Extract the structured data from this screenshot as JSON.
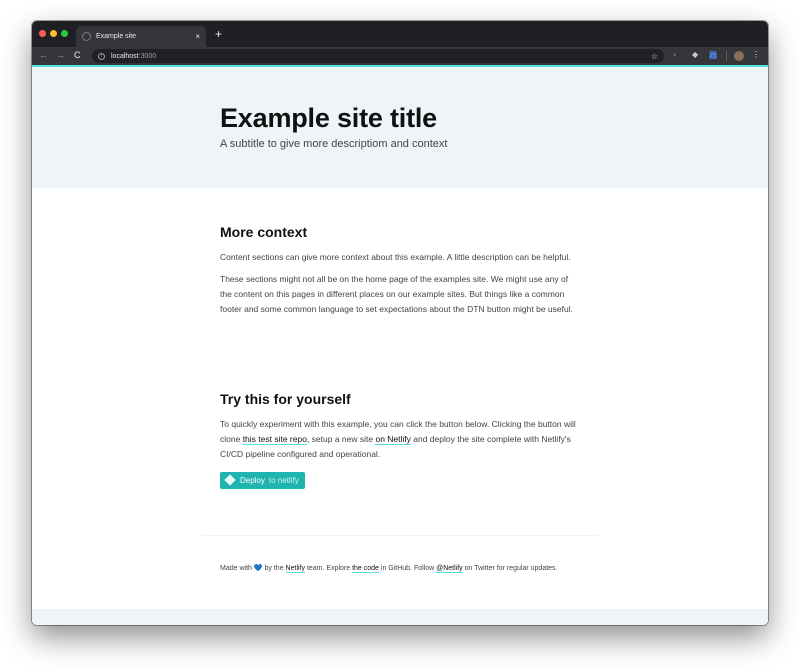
{
  "browser": {
    "tab_title": "Example site",
    "tab_close": "×",
    "new_tab": "+",
    "url_host": "localhost",
    "url_port": ":3000",
    "star": "☆",
    "menu": "⋮",
    "back": "←",
    "forward": "→",
    "reload": "C"
  },
  "hero": {
    "title": "Example site title",
    "subtitle": "A subtitle to give more descriptiom and context"
  },
  "section1": {
    "heading": "More context",
    "paragraphs": [
      "Content sections can give more context about this example. A little description can be helpful.",
      "These sections might not all be on the home page of the examples site. We might use any of the content on this pages in different places on our example sites. But things like a common footer and some common language to set expectations about the DTN button might be useful."
    ]
  },
  "section2": {
    "heading": "Try this for yourself",
    "text_a": "To quickly experiment with this example, you can click the button below. Clicking the button will clone ",
    "link_repo": "this test site repo",
    "text_b": ", setup a new site ",
    "link_netlify": "on Netlify",
    "text_c": " and deploy the site complete with Netlify's CI/CD pipeline configured and operational.",
    "deploy_label_a": "Deploy",
    "deploy_label_b": " to netlify"
  },
  "footer": {
    "made_with": "Made with ",
    "heart": "💙",
    "by_the": " by the ",
    "netlify_link": "Netlify",
    "team_explore": " team. Explore ",
    "code_link": "the code",
    "in_github": " in GitHub. Follow ",
    "twitter_link": "@Netlify",
    "on_twitter": " on Twitter for regular updates."
  },
  "colors": {
    "accent": "#4fe3dc",
    "button": "#20b4b0",
    "hero_bg": "#eef4f7"
  }
}
